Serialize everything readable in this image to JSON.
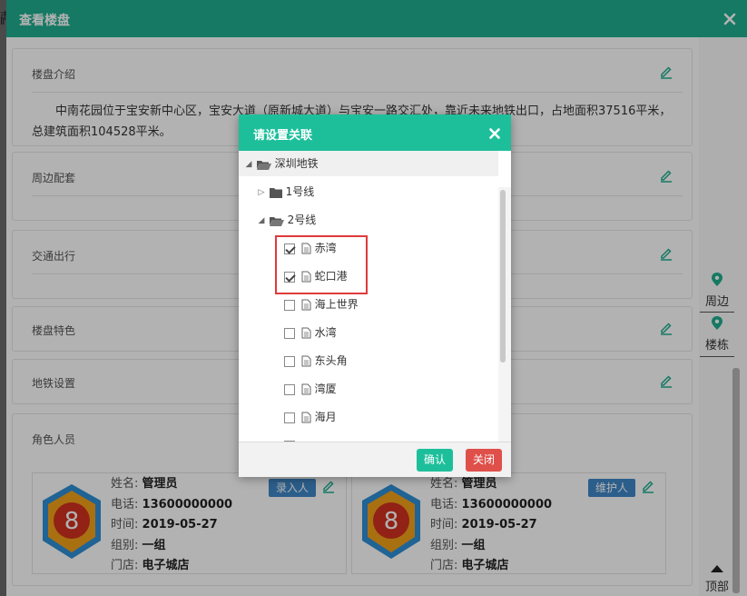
{
  "edge_fragments": [
    "市",
    "Ⅱ"
  ],
  "outer_modal": {
    "title": "查看楼盘"
  },
  "panels": [
    {
      "title": "楼盘介绍",
      "text": "中南花园位于宝安新中心区，宝安大道（原新城大道）与宝安一路交汇处，靠近未来地铁出口，占地面积37516平米，总建筑面积104528平米。"
    },
    {
      "title": "周边配套"
    },
    {
      "title": "交通出行"
    },
    {
      "title": "楼盘特色"
    },
    {
      "title": "地铁设置"
    },
    {
      "title": "角色人员"
    }
  ],
  "rail": {
    "nearby": "周边",
    "building": "楼栋",
    "top": "顶部"
  },
  "people": [
    {
      "tag": "录入人",
      "badge_number": "8",
      "rows": [
        {
          "label": "姓名:",
          "value": "管理员"
        },
        {
          "label": "电话:",
          "value": "13600000000"
        },
        {
          "label": "时间:",
          "value": "2019-05-27"
        },
        {
          "label": "组别:",
          "value": "一组"
        },
        {
          "label": "门店:",
          "value": "电子城店"
        }
      ]
    },
    {
      "tag": "维护人",
      "badge_number": "8",
      "rows": [
        {
          "label": "姓名:",
          "value": "管理员"
        },
        {
          "label": "电话:",
          "value": "13600000000"
        },
        {
          "label": "时间:",
          "value": "2019-05-27"
        },
        {
          "label": "组别:",
          "value": "一组"
        },
        {
          "label": "门店:",
          "value": "电子城店"
        }
      ]
    }
  ],
  "dialog": {
    "title": "请设置关联",
    "confirm": "确认",
    "close": "关闭",
    "tree": {
      "root": "深圳地铁",
      "line1": "1号线",
      "line2": "2号线",
      "stations": [
        {
          "name": "赤湾",
          "checked": true
        },
        {
          "name": "蛇口港",
          "checked": true
        },
        {
          "name": "海上世界",
          "checked": false
        },
        {
          "name": "水湾",
          "checked": false
        },
        {
          "name": "东头角",
          "checked": false
        },
        {
          "name": "湾厦",
          "checked": false
        },
        {
          "name": "海月",
          "checked": false
        }
      ]
    }
  },
  "colors": {
    "header": "#1fae8f",
    "dialog_header": "#1dbf9b",
    "danger": "#e0504a",
    "tag": "#3f87c7",
    "highlight": "#e03a3a"
  }
}
